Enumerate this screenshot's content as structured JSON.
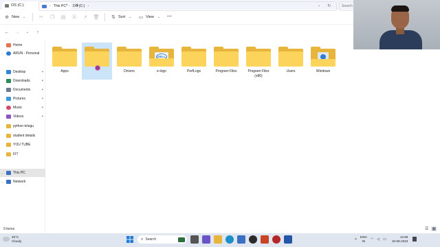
{
  "window": {
    "tab_title": "OS (C:)",
    "tab_close": "×",
    "new_tab": "+"
  },
  "toolbar": {
    "new_label": "New",
    "sort_label": "Sort",
    "view_label": "View",
    "more_label": "···"
  },
  "address": {
    "crumbs": [
      "This PC",
      "OS (C:)"
    ],
    "search_placeholder": "Search OS (C:)"
  },
  "sidebar": {
    "items": [
      {
        "label": "Home",
        "icon": "home-icon",
        "color": "#e5754d",
        "pinned": false
      },
      {
        "label": "ARUN - Personal",
        "icon": "onedrive-icon",
        "color": "#2b7cd3",
        "pinned": false
      },
      {
        "label": "Desktop",
        "icon": "desktop-icon",
        "color": "#2f86d9",
        "pinned": true
      },
      {
        "label": "Downloads",
        "icon": "downloads-icon",
        "color": "#2e8b57",
        "pinned": true
      },
      {
        "label": "Documents",
        "icon": "documents-icon",
        "color": "#6b7b93",
        "pinned": true
      },
      {
        "label": "Pictures",
        "icon": "pictures-icon",
        "color": "#3a9ad9",
        "pinned": true
      },
      {
        "label": "Music",
        "icon": "music-icon",
        "color": "#d4486b",
        "pinned": true
      },
      {
        "label": "Videos",
        "icon": "videos-icon",
        "color": "#8b55c7",
        "pinned": true
      },
      {
        "label": "python telugu",
        "icon": "folder-icon",
        "color": "#e8b53c",
        "pinned": false
      },
      {
        "label": "student details",
        "icon": "folder-icon",
        "color": "#e8b53c",
        "pinned": false
      },
      {
        "label": "YOU TUBE",
        "icon": "folder-icon",
        "color": "#e8b53c",
        "pinned": false
      },
      {
        "label": "FIT",
        "icon": "folder-icon",
        "color": "#e8b53c",
        "pinned": false
      },
      {
        "label": "This PC",
        "icon": "this-pc-icon",
        "color": "#3b6fc4",
        "pinned": false
      },
      {
        "label": "Network",
        "icon": "network-icon",
        "color": "#3b6fc4",
        "pinned": false
      }
    ]
  },
  "folders": [
    {
      "label": "Apps",
      "label2": ""
    },
    {
      "label": "",
      "label2": ""
    },
    {
      "label": "Drivers",
      "label2": ""
    },
    {
      "label": "e-logo",
      "label2": ""
    },
    {
      "label": "PerfLogs",
      "label2": ""
    },
    {
      "label": "Program Files",
      "label2": ""
    },
    {
      "label": "Program Files",
      "label2": "(x86)"
    },
    {
      "label": "Users",
      "label2": ""
    },
    {
      "label": "Windows",
      "label2": ""
    }
  ],
  "overlay": {
    "dell_text": "DELL"
  },
  "status": {
    "item_count": "9 items"
  },
  "taskbar": {
    "temperature": "25°C",
    "condition": "Cloudy",
    "search_label": "Search",
    "language_line1": "ENG",
    "language_line2": "IN",
    "time": "12:59",
    "date": "19-08-2023"
  },
  "colors": {
    "folder_back": "#e8b53c",
    "folder_front": "#fcd45c",
    "selection": "#cce4f7"
  }
}
